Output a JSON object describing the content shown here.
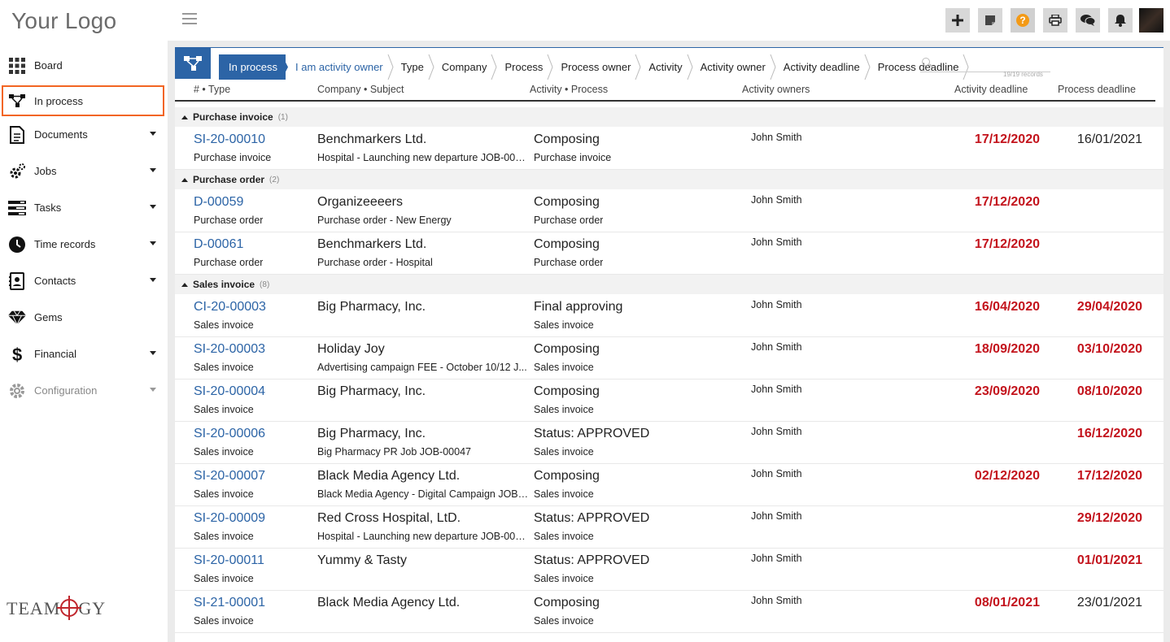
{
  "logo": "Your Logo",
  "brand": {
    "left": "TEAM",
    "right": "GY"
  },
  "sidebar": {
    "items": [
      {
        "key": "board",
        "label": "Board",
        "icon": "grid-icon",
        "caret": false
      },
      {
        "key": "in-process",
        "label": "In process",
        "icon": "process-icon",
        "caret": false,
        "active": true
      },
      {
        "key": "documents",
        "label": "Documents",
        "icon": "document-icon",
        "caret": true
      },
      {
        "key": "jobs",
        "label": "Jobs",
        "icon": "jobs-gear-icon",
        "caret": true
      },
      {
        "key": "tasks",
        "label": "Tasks",
        "icon": "tasks-icon",
        "caret": true
      },
      {
        "key": "time-records",
        "label": "Time records",
        "icon": "clock-icon",
        "caret": true
      },
      {
        "key": "contacts",
        "label": "Contacts",
        "icon": "contacts-icon",
        "caret": true
      },
      {
        "key": "gems",
        "label": "Gems",
        "icon": "diamond-icon",
        "caret": false
      },
      {
        "key": "financial",
        "label": "Financial",
        "icon": "dollar-icon",
        "caret": true
      },
      {
        "key": "configuration",
        "label": "Configuration",
        "icon": "gear-icon",
        "caret": true,
        "disabled": true
      }
    ]
  },
  "topbar": {
    "buttons": [
      "add-icon",
      "note-icon",
      "help-icon",
      "print-icon",
      "chat-icon",
      "bell-icon"
    ],
    "help_label": "?"
  },
  "breadcrumbs": [
    "In process",
    "I am activity owner",
    "Type",
    "Company",
    "Process",
    "Process owner",
    "Activity",
    "Activity owner",
    "Activity deadline",
    "Process deadline"
  ],
  "search": {
    "placeholder": "",
    "records": "19/19 records"
  },
  "columns": {
    "num_type": "# • Type",
    "company_subject": "Company • Subject",
    "activity_process": "Activity • Process",
    "owners": "Activity owners",
    "activity_deadline": "Activity deadline",
    "process_deadline": "Process deadline"
  },
  "groups": [
    {
      "name": "Purchase invoice",
      "count": "(1)",
      "rows": [
        {
          "num": "SI-20-00010",
          "type": "Purchase invoice",
          "company": "Benchmarkers Ltd.",
          "subject": "Hospital - Launching new departure JOB-000...",
          "activity": "Composing",
          "process": "Purchase invoice",
          "owner": "John Smith",
          "adl": "17/12/2020",
          "adl_red": true,
          "pdl": "16/01/2021",
          "pdl_red": false
        }
      ]
    },
    {
      "name": "Purchase order",
      "count": "(2)",
      "rows": [
        {
          "num": "D-00059",
          "type": "Purchase order",
          "company": "Organizeeeers",
          "subject": "Purchase order - New Energy",
          "activity": "Composing",
          "process": "Purchase order",
          "owner": "John Smith",
          "adl": "17/12/2020",
          "adl_red": true,
          "pdl": "",
          "pdl_red": false
        },
        {
          "num": "D-00061",
          "type": "Purchase order",
          "company": "Benchmarkers Ltd.",
          "subject": "Purchase order - Hospital",
          "activity": "Composing",
          "process": "Purchase order",
          "owner": "John Smith",
          "adl": "17/12/2020",
          "adl_red": true,
          "pdl": "",
          "pdl_red": false
        }
      ]
    },
    {
      "name": "Sales invoice",
      "count": "(8)",
      "rows": [
        {
          "num": "CI-20-00003",
          "type": "Sales invoice",
          "company": "Big Pharmacy, Inc.",
          "subject": "",
          "activity": "Final approving",
          "process": "Sales invoice",
          "owner": "John Smith",
          "adl": "16/04/2020",
          "adl_red": true,
          "pdl": "29/04/2020",
          "pdl_red": true
        },
        {
          "num": "SI-20-00003",
          "type": "Sales invoice",
          "company": "Holiday Joy",
          "subject": "Advertising campaign FEE - October 10/12 J...",
          "activity": "Composing",
          "process": "Sales invoice",
          "owner": "John Smith",
          "adl": "18/09/2020",
          "adl_red": true,
          "pdl": "03/10/2020",
          "pdl_red": true
        },
        {
          "num": "SI-20-00004",
          "type": "Sales invoice",
          "company": "Big Pharmacy, Inc.",
          "subject": "",
          "activity": "Composing",
          "process": "Sales invoice",
          "owner": "John Smith",
          "adl": "23/09/2020",
          "adl_red": true,
          "pdl": "08/10/2020",
          "pdl_red": true
        },
        {
          "num": "SI-20-00006",
          "type": "Sales invoice",
          "company": "Big Pharmacy, Inc.",
          "subject": "Big Pharmacy PR Job JOB-00047",
          "activity": "Status: APPROVED",
          "process": "Sales invoice",
          "owner": "John Smith",
          "adl": "",
          "adl_red": false,
          "pdl": "16/12/2020",
          "pdl_red": true
        },
        {
          "num": "SI-20-00007",
          "type": "Sales invoice",
          "company": "Black Media Agency Ltd.",
          "subject": "Black Media Agency - Digital Campaign JOB-...",
          "activity": "Composing",
          "process": "Sales invoice",
          "owner": "John Smith",
          "adl": "02/12/2020",
          "adl_red": true,
          "pdl": "17/12/2020",
          "pdl_red": true
        },
        {
          "num": "SI-20-00009",
          "type": "Sales invoice",
          "company": "Red Cross Hospital, LtD.",
          "subject": "Hospital - Launching new departure JOB-000...",
          "activity": "Status: APPROVED",
          "process": "Sales invoice",
          "owner": "John Smith",
          "adl": "",
          "adl_red": false,
          "pdl": "29/12/2020",
          "pdl_red": true
        },
        {
          "num": "SI-20-00011",
          "type": "Sales invoice",
          "company": "Yummy & Tasty",
          "subject": "",
          "activity": "Status: APPROVED",
          "process": "Sales invoice",
          "owner": "John Smith",
          "adl": "",
          "adl_red": false,
          "pdl": "01/01/2021",
          "pdl_red": true
        },
        {
          "num": "SI-21-00001",
          "type": "Sales invoice",
          "company": "Black Media Agency Ltd.",
          "subject": "",
          "activity": "Composing",
          "process": "Sales invoice",
          "owner": "John Smith",
          "adl": "08/01/2021",
          "adl_red": true,
          "pdl": "23/01/2021",
          "pdl_red": false
        }
      ]
    }
  ],
  "colors": {
    "accent": "#2c64a6",
    "highlight": "#f26522",
    "danger": "#c3131c",
    "help": "#f39a16"
  }
}
